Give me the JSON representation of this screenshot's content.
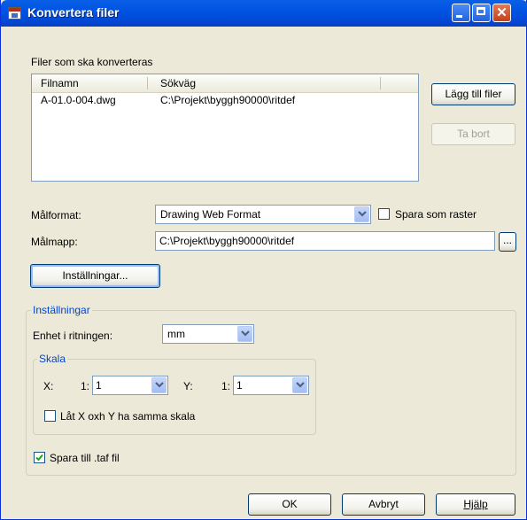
{
  "window": {
    "title": "Konvertera filer",
    "icons": [
      "app-icon",
      "minimize-icon",
      "maximize-icon",
      "close-icon"
    ],
    "accent_color": "#0054e3",
    "group_title_color": "#0046d5"
  },
  "files": {
    "section_label": "Filer som ska konverteras",
    "columns": [
      "Filnamn",
      "Sökväg"
    ],
    "rows": [
      {
        "filename": "A-01.0-004.dwg",
        "path": "C:\\Projekt\\byggh90000\\ritdef"
      }
    ],
    "add_button": "Lägg till filer",
    "remove_button": "Ta bort"
  },
  "target": {
    "format_label": "Målformat:",
    "format_value": "Drawing Web Format",
    "save_as_raster_label": "Spara som raster",
    "save_as_raster_checked": false,
    "folder_label": "Målmapp:",
    "folder_value": "C:\\Projekt\\byggh90000\\ritdef",
    "browse_button": "...",
    "settings_button": "Inställningar..."
  },
  "settings": {
    "group_title": "Inställningar",
    "unit_label": "Enhet i ritningen:",
    "unit_value": "mm",
    "scale": {
      "group_title": "Skala",
      "x_label": "X:",
      "x_prefix": "1:",
      "x_value": "1",
      "y_label": "Y:",
      "y_prefix": "1:",
      "y_value": "1",
      "same_scale_label": "Låt X oxh Y ha samma skala",
      "same_scale_checked": false
    },
    "save_taf_label": "Spara till .taf fil",
    "save_taf_checked": true
  },
  "footer": {
    "ok_button": "OK",
    "cancel_button": "Avbryt",
    "help_button": "Hjälp"
  }
}
